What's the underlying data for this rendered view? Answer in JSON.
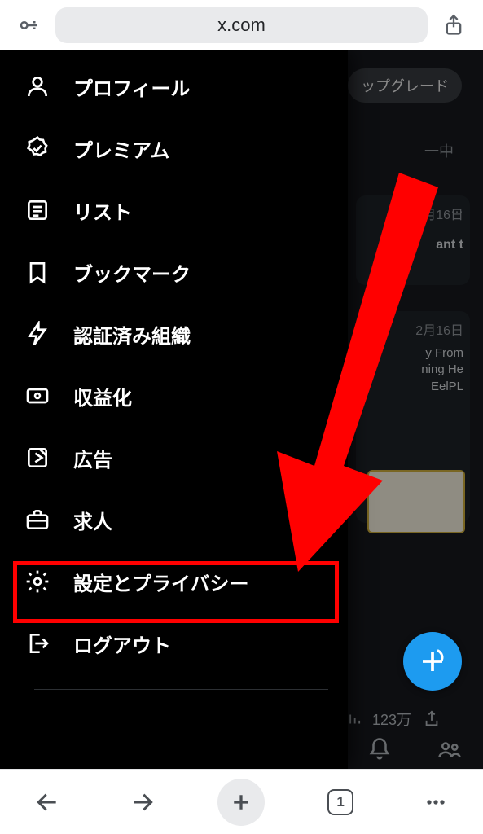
{
  "browser": {
    "url": "x.com",
    "tab_count": "1"
  },
  "background": {
    "upgrade_pill": "ップグレード",
    "sub_text": "一中",
    "card1_date": "月16日",
    "card1_text": "ant t",
    "card2_date": "2月16日",
    "card2_line1": "y From",
    "card2_line2": "ning He",
    "card2_line3": "EelPL",
    "views": "123万"
  },
  "nav": {
    "profile": "プロフィール",
    "premium": "プレミアム",
    "lists": "リスト",
    "bookmarks": "ブックマーク",
    "verified_orgs": "認証済み組織",
    "monetization": "収益化",
    "ads": "広告",
    "jobs": "求人",
    "settings_privacy": "設定とプライバシー",
    "logout": "ログアウト"
  }
}
